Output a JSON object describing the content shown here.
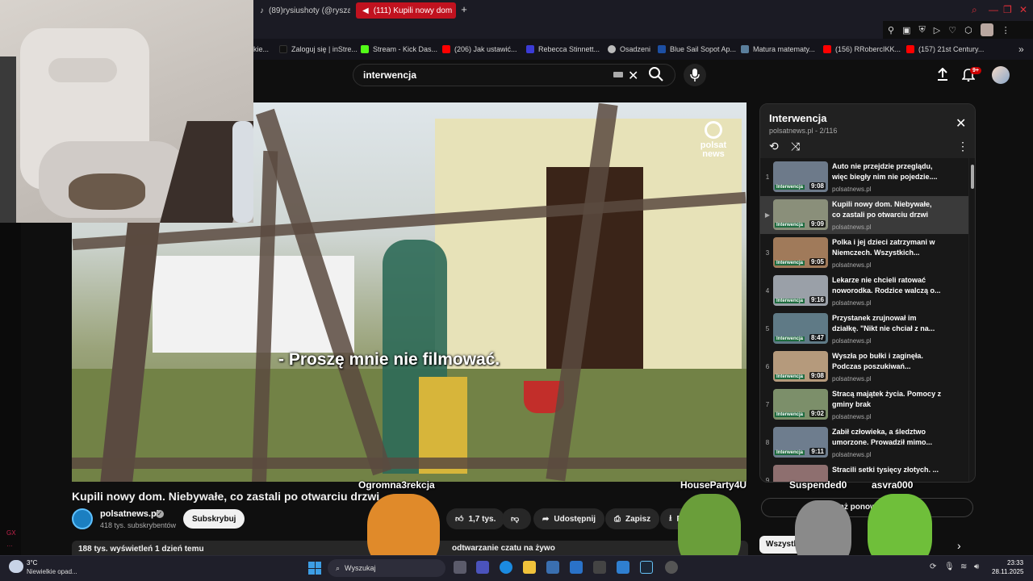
{
  "browser": {
    "tabs": [
      {
        "label": "(89)rysiushoty (@ryszard",
        "icon": "tiktok-icon"
      },
      {
        "label": "(111) Kupili nowy dom",
        "icon": "speaker-icon",
        "active": true
      }
    ],
    "new_tab": "+",
    "window_controls": [
      "search-icon",
      "minimize-icon",
      "restore-icon",
      "close-icon"
    ],
    "bookmarks": [
      {
        "label": "kie...",
        "color": "#444"
      },
      {
        "label": "Zaloguj się | inStre...",
        "color": "#111"
      },
      {
        "label": "Stream - Kick Das...",
        "color": "#53fc18"
      },
      {
        "label": "(206) Jak ustawić...",
        "color": "#ff0000"
      },
      {
        "label": "Rebecca Stinnett...",
        "color": "#3b3bd6"
      },
      {
        "label": "Osadzeni",
        "color": "#bbbbbb"
      },
      {
        "label": "Blue Sail Sopot Ap...",
        "color": "#1d4fa3"
      },
      {
        "label": "Matura matematy...",
        "color": "#5a7e9c"
      },
      {
        "label": "(156) RRobercIKK...",
        "color": "#ff0000"
      },
      {
        "label": "(157) 21st Century...",
        "color": "#ff0000"
      }
    ],
    "bookmarks_more": "»"
  },
  "youtube": {
    "search": {
      "value": "interwencja"
    },
    "notifications_badge": "9+",
    "video": {
      "title": "Kupili nowy dom. Niebywałe, co zastali po otwarciu drzwi",
      "subtitle": "- Proszę mnie nie filmować.",
      "watermark": "polsat news",
      "channel": "polsatnews.pl",
      "subscribers": "418 tys. subskrybentów",
      "subscribe_label": "Subskrybuj",
      "likes": "1,7 tys.",
      "share_label": "Udostępnij",
      "save_label": "Zapisz",
      "download_label": "P",
      "views_line": "188 tys. wyświetleń  1 dzień temu",
      "chat_replay": "odtwarzanie czatu na żywo"
    },
    "playlist": {
      "title": "Interwencja",
      "meta": "polsatnews.pl - 2/116",
      "items": [
        {
          "idx": "1",
          "title": "Auto nie przejdzie przeglądu, więc biegły nim nie pojedzie....",
          "channel": "polsatnews.pl",
          "duration": "9:08",
          "tag": "Interwencja",
          "color": "#6d7a8a"
        },
        {
          "idx": "▶",
          "title": "Kupili nowy dom. Niebywałe, co zastali po otwarciu drzwi",
          "channel": "polsatnews.pl",
          "duration": "9:09",
          "tag": "Interwencja",
          "color": "#8a8f7a",
          "active": true
        },
        {
          "idx": "3",
          "title": "Polka i jej dzieci zatrzymani w Niemczech. Wszystkich...",
          "channel": "polsatnews.pl",
          "duration": "9:05",
          "tag": "Interwencja",
          "color": "#a07a5a"
        },
        {
          "idx": "4",
          "title": "Lekarze nie chcieli ratować noworodka. Rodzice walczą o...",
          "channel": "polsatnews.pl",
          "duration": "9:16",
          "tag": "Interwencja",
          "color": "#9aa0a8"
        },
        {
          "idx": "5",
          "title": "Przystanek zrujnował im działkę. \"Nikt nie chciał z na...",
          "channel": "polsatnews.pl",
          "duration": "8:47",
          "tag": "Interwencja",
          "color": "#5f7a86"
        },
        {
          "idx": "6",
          "title": "Wyszła po bułki i zaginęła. Podczas poszukiwań...",
          "channel": "polsatnews.pl",
          "duration": "9:08",
          "tag": "Interwencja",
          "color": "#b59a7c"
        },
        {
          "idx": "7",
          "title": "Stracą majątek życia. Pomocy z gminy brak",
          "channel": "polsatnews.pl",
          "duration": "9:02",
          "tag": "Interwencja",
          "color": "#7c8f6a"
        },
        {
          "idx": "8",
          "title": "Zabił człowieka, a śledztwo umorzone. Prowadził mimo...",
          "channel": "polsatnews.pl",
          "duration": "9:11",
          "tag": "Interwencja",
          "color": "#6e7d8e"
        },
        {
          "idx": "9",
          "title": "Stracili setki tysięcy złotych. ...",
          "channel": "polsatnews.pl",
          "duration": "",
          "tag": "",
          "color": "#8e6f6f"
        }
      ]
    },
    "replay_label": "Pokaż ponownie o...tu",
    "chips": {
      "all": "Wszystkie",
      "next": "›"
    }
  },
  "overlay": {
    "viewers": [
      {
        "name": "Ogromna3rekcja",
        "color": "#e08a2a"
      },
      {
        "name": "HouseParty4U",
        "color": "#6a9e3a"
      },
      {
        "name": "Suspended0",
        "color": "#8a8a8a"
      },
      {
        "name": "asvra000",
        "color": "#6fbf3a"
      }
    ],
    "side_marks": [
      "GX",
      "…"
    ]
  },
  "taskbar": {
    "weather_temp": "3°C",
    "weather_desc": "Niewielkie opad...",
    "search_placeholder": "Wyszukaj",
    "time": "23:33",
    "date": "28.11.2025"
  }
}
